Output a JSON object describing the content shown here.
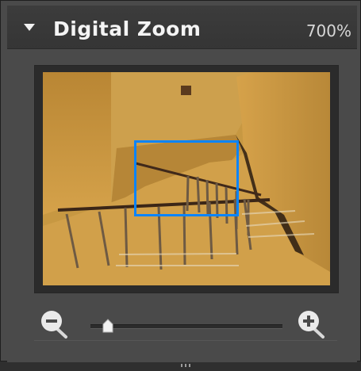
{
  "panel": {
    "title": "Digital Zoom",
    "zoom_level": "700%"
  },
  "icons": {
    "collapse": "triangle-down-icon",
    "zoom_out": "zoom-out-icon",
    "zoom_in": "zoom-in-icon"
  },
  "slider": {
    "value_fraction": 0.06
  },
  "colors": {
    "selection": "#0a84ff",
    "panel": "#4a4a4a",
    "header": "#3c3c3c"
  }
}
